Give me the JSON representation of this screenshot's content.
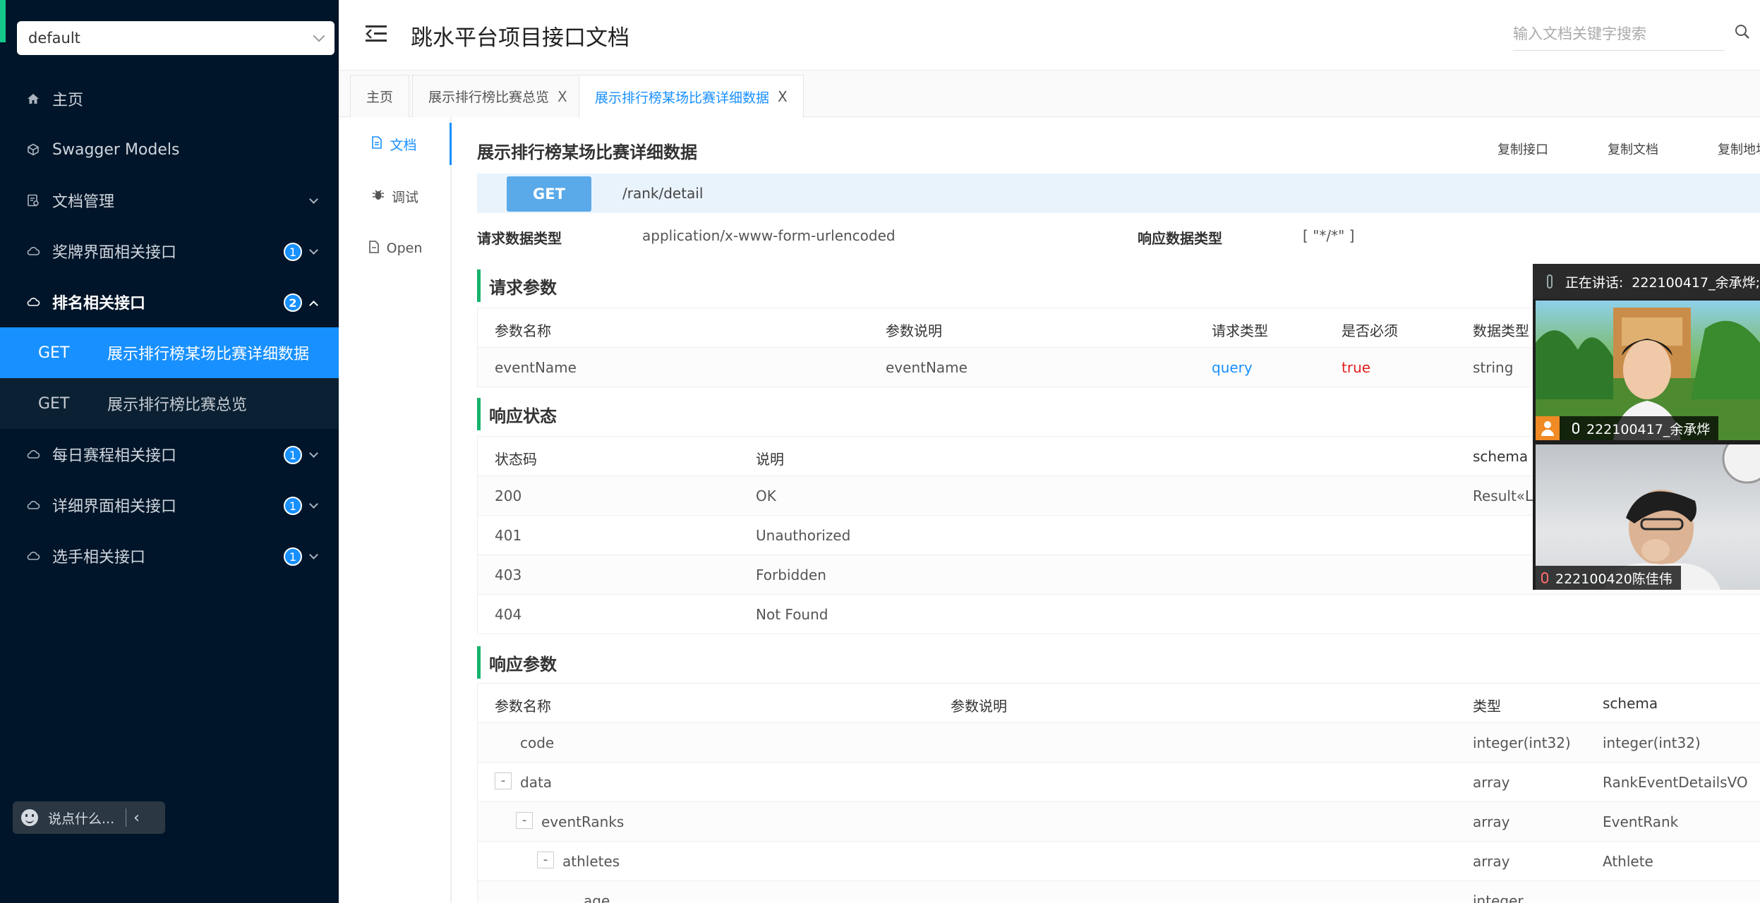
{
  "sidebar": {
    "group_select": "default",
    "menu": [
      {
        "label": "主页",
        "icon": "home-icon"
      },
      {
        "label": "Swagger Models",
        "icon": "cube-icon"
      },
      {
        "label": "文档管理",
        "icon": "doc-manage-icon"
      },
      {
        "label": "奖牌界面相关接口",
        "icon": "cloud-icon",
        "badge": "1"
      },
      {
        "label": "排名相关接口",
        "icon": "cloud-icon",
        "badge": "2"
      },
      {
        "label": "每日赛程相关接口",
        "icon": "cloud-icon",
        "badge": "1"
      },
      {
        "label": "详细界面相关接口",
        "icon": "cloud-icon",
        "badge": "1"
      },
      {
        "label": "选手相关接口",
        "icon": "cloud-icon",
        "badge": "1"
      }
    ],
    "sub_items": [
      {
        "method": "GET",
        "title": "展示排行榜某场比赛详细数据"
      },
      {
        "method": "GET",
        "title": "展示排行榜比赛总览"
      }
    ],
    "chat_placeholder": "说点什么..."
  },
  "header": {
    "title": "跳水平台项目接口文档",
    "search_placeholder": "输入文档关键字搜索"
  },
  "tabs": [
    {
      "label": "主页"
    },
    {
      "label": "展示排行榜比赛总览",
      "close": "X"
    },
    {
      "label": "展示排行榜某场比赛详细数据",
      "close": "X"
    }
  ],
  "side_tabs": [
    {
      "label": "文档",
      "icon": "document-icon"
    },
    {
      "label": "调试",
      "icon": "bug-icon"
    },
    {
      "label": "Open",
      "icon": "file-icon"
    }
  ],
  "api": {
    "title": "展示排行榜某场比赛详细数据",
    "copy_buttons": [
      "复制接口",
      "复制文档",
      "复制地址"
    ],
    "method": "GET",
    "path": "/rank/detail",
    "request_type_label": "请求数据类型",
    "request_type_value": "application/x-www-form-urlencoded",
    "response_type_label": "响应数据类型",
    "response_type_value": "[ \"*/*\" ]"
  },
  "request_params": {
    "title": "请求参数",
    "headers": [
      "参数名称",
      "参数说明",
      "请求类型",
      "是否必须",
      "数据类型"
    ],
    "rows": [
      [
        "eventName",
        "eventName",
        "query",
        "true",
        "string"
      ]
    ]
  },
  "response_status": {
    "title": "响应状态",
    "headers": [
      "状态码",
      "说明",
      "schema"
    ],
    "rows": [
      [
        "200",
        "OK",
        "Result«List"
      ],
      [
        "401",
        "Unauthorized",
        ""
      ],
      [
        "403",
        "Forbidden",
        ""
      ],
      [
        "404",
        "Not Found",
        ""
      ]
    ]
  },
  "response_params": {
    "title": "响应参数",
    "headers": [
      "参数名称",
      "参数说明",
      "类型",
      "schema"
    ],
    "rows": [
      {
        "name": "code",
        "type": "integer(int32)",
        "schema": "integer(int32)",
        "toggle": ""
      },
      {
        "name": "data",
        "type": "array",
        "schema": "RankEventDetailsVO",
        "toggle": "-"
      },
      {
        "name": "eventRanks",
        "type": "array",
        "schema": "EventRank",
        "toggle": "-"
      },
      {
        "name": "athletes",
        "type": "array",
        "schema": "Athlete",
        "toggle": "-"
      },
      {
        "name": "age",
        "type": "integer",
        "schema": "",
        "toggle": ""
      }
    ]
  },
  "video": {
    "speaking_label": "正在讲话:",
    "speaking_name": "222100417_余承烨;",
    "tiles": [
      {
        "name": "222100417_余承烨"
      },
      {
        "name": "222100420陈佳伟"
      }
    ]
  },
  "colors": {
    "sidebar_bg": "#001529",
    "accent": "#1890ff",
    "section_bar": "#16b36c",
    "method_badge": "#5aa9e9",
    "required_true": "#e02020"
  }
}
